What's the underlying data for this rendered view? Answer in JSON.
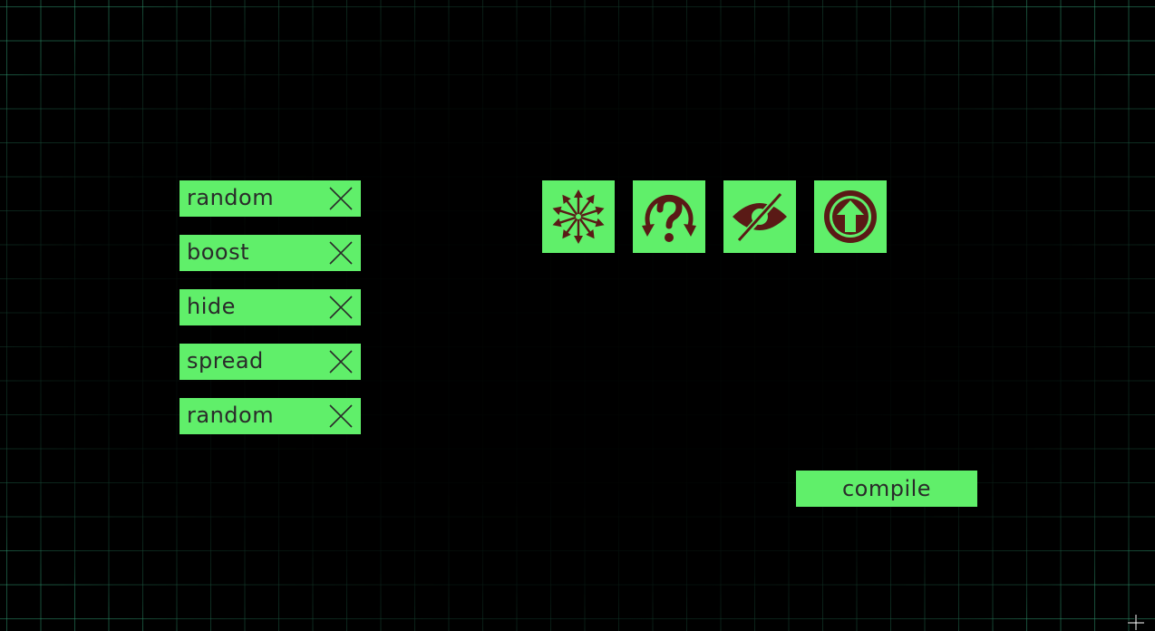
{
  "sequence": {
    "items": [
      {
        "label": "random"
      },
      {
        "label": "boost"
      },
      {
        "label": "hide"
      },
      {
        "label": "spread"
      },
      {
        "label": "random"
      }
    ],
    "remove_icon": "close-x-icon"
  },
  "palette": {
    "tools": [
      {
        "name": "spread",
        "icon": "spread-arrows-icon"
      },
      {
        "name": "random",
        "icon": "question-cycle-icon"
      },
      {
        "name": "hide",
        "icon": "eye-off-icon"
      },
      {
        "name": "boost",
        "icon": "arrow-up-circle-icon"
      }
    ]
  },
  "actions": {
    "compile_label": "compile"
  },
  "colors": {
    "background": "#000000",
    "grid": "#2e966e",
    "tile": "#60ef6a",
    "icon": "#5a1a16",
    "text": "#2a2a2a"
  }
}
